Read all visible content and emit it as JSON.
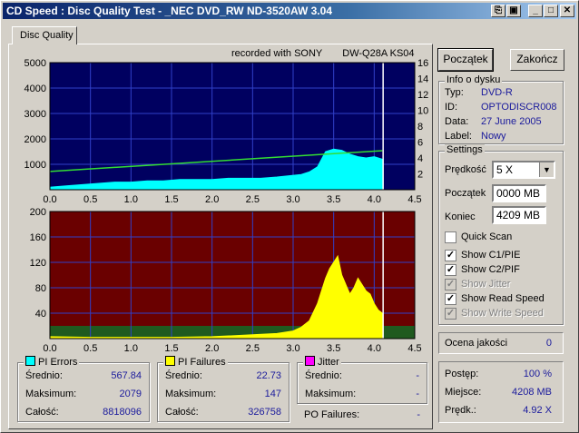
{
  "window": {
    "title": "CD Speed : Disc Quality Test - _NEC    DVD_RW ND-3520AW 3.04"
  },
  "tab": {
    "label": "Disc Quality"
  },
  "recorded": {
    "prefix": "recorded with SONY",
    "media": "DW-Q28A KS04"
  },
  "buttons": {
    "start": "Początek",
    "end": "Zakończ"
  },
  "disc_info": {
    "title": "Info o dysku",
    "type_label": "Typ:",
    "type": "DVD-R",
    "id_label": "ID:",
    "id": "OPTODISCR008",
    "date_label": "Data:",
    "date": "27 June 2005",
    "label_label": "Label:",
    "label": "Nowy"
  },
  "settings": {
    "title": "Settings",
    "speed_label": "Prędkość",
    "speed": "5 X",
    "start_label": "Początek",
    "start": "0000 MB",
    "end_label": "Koniec",
    "end": "4209 MB",
    "quick_scan": "Quick Scan",
    "show_c1": "Show C1/PIE",
    "show_c2": "Show C2/PIF",
    "show_jitter": "Show Jitter",
    "show_read": "Show Read Speed",
    "show_write": "Show Write Speed"
  },
  "quality": {
    "label": "Ocena jakości",
    "value": "0"
  },
  "progress": {
    "progress_label": "Postęp:",
    "progress": "100 %",
    "position_label": "Miejsce:",
    "position": "4208 MB",
    "speed_label": "Prędk.:",
    "speed": "4.92 X"
  },
  "pi_errors": {
    "title": "PI Errors",
    "color": "#00ffff",
    "avg_label": "Średnio:",
    "avg": "567.84",
    "max_label": "Maksimum:",
    "max": "2079",
    "total_label": "Całość:",
    "total": "8818096"
  },
  "pi_failures": {
    "title": "PI Failures",
    "color": "#ffff00",
    "avg_label": "Średnio:",
    "avg": "22.73",
    "max_label": "Maksimum:",
    "max": "147",
    "total_label": "Całość:",
    "total": "326758"
  },
  "jitter": {
    "title": "Jitter",
    "color": "#ff00ff",
    "avg_label": "Średnio:",
    "avg": "-",
    "max_label": "Maksimum:",
    "max": "-"
  },
  "po_failures": {
    "label": "PO Failures:",
    "value": "-"
  },
  "chart_data": [
    {
      "type": "area",
      "title": "PI Errors",
      "xlim": [
        0,
        4.5
      ],
      "ylim": [
        0,
        5000
      ],
      "y2lim": [
        0,
        16
      ],
      "xticks": [
        "0.0",
        "0.5",
        "1.0",
        "1.5",
        "2.0",
        "2.5",
        "3.0",
        "3.5",
        "4.0",
        "4.5"
      ],
      "yticks": [
        "1000",
        "2000",
        "3000",
        "4000",
        "5000"
      ],
      "y2ticks": [
        "2",
        "4",
        "6",
        "8",
        "10",
        "12",
        "14",
        "16"
      ],
      "grid": true,
      "series": [
        {
          "name": "PI Errors",
          "color": "#00ffff",
          "x": [
            0.0,
            0.2,
            0.4,
            0.6,
            0.8,
            1.0,
            1.2,
            1.4,
            1.6,
            1.8,
            2.0,
            2.2,
            2.4,
            2.6,
            2.8,
            2.95,
            3.1,
            3.2,
            3.3,
            3.4,
            3.5,
            3.6,
            3.7,
            3.8,
            3.9,
            4.0,
            4.1
          ],
          "y": [
            100,
            150,
            200,
            250,
            300,
            300,
            350,
            350,
            400,
            400,
            400,
            450,
            450,
            450,
            500,
            550,
            600,
            700,
            900,
            1500,
            1600,
            1550,
            1400,
            1300,
            1250,
            1300,
            1200
          ]
        },
        {
          "name": "Read Speed",
          "color": "#33dd33",
          "x": [
            0.0,
            4.1
          ],
          "y": [
            2.3,
            4.92
          ]
        }
      ]
    },
    {
      "type": "area",
      "title": "PI Failures",
      "xlim": [
        0,
        4.5
      ],
      "ylim": [
        0,
        200
      ],
      "xticks": [
        "0.0",
        "0.5",
        "1.0",
        "1.5",
        "2.0",
        "2.5",
        "3.0",
        "3.5",
        "4.0",
        "4.5"
      ],
      "yticks": [
        "40",
        "80",
        "120",
        "160",
        "200"
      ],
      "grid": true,
      "series": [
        {
          "name": "PI Failures",
          "color": "#ffff00",
          "x": [
            0.0,
            0.5,
            1.0,
            1.5,
            2.0,
            2.5,
            2.8,
            3.0,
            3.1,
            3.2,
            3.3,
            3.35,
            3.4,
            3.45,
            3.5,
            3.55,
            3.6,
            3.7,
            3.75,
            3.8,
            3.85,
            3.9,
            3.95,
            4.0,
            4.05,
            4.1
          ],
          "y": [
            3,
            2,
            2,
            2,
            3,
            6,
            8,
            12,
            18,
            28,
            55,
            75,
            95,
            110,
            120,
            130,
            100,
            70,
            80,
            95,
            85,
            75,
            70,
            55,
            45,
            40
          ]
        }
      ]
    }
  ]
}
